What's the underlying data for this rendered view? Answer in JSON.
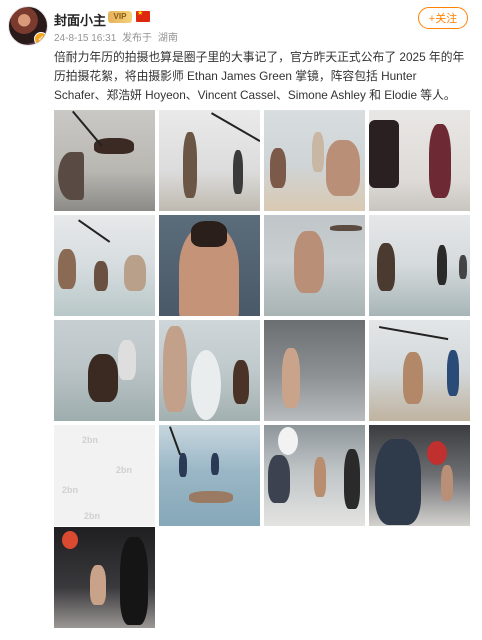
{
  "user": {
    "name": "封面小主",
    "vip_label": "V",
    "date_time": "24-8-15 16:31",
    "device": "发布于",
    "location": "湖南"
  },
  "follow_label": "+关注",
  "post_text": "倍耐力年历的拍摄也算是圈子里的大事记了，官方昨天正式公布了 2025 年的年历拍摄花絮，将由摄影师 Ethan James Green 掌镜，阵容包括 Hunter Schafer、郑浩妍 Hoyeon、Vincent Cassel、Simone Ashley 和 Elodie 等人。",
  "icons": [
    "verified-badge-icon",
    "vip-badge-icon",
    "china-flag-icon"
  ],
  "accent_color": "#ff8200",
  "photos": [
    {
      "name": "photo-1"
    },
    {
      "name": "photo-2"
    },
    {
      "name": "photo-3"
    },
    {
      "name": "photo-4"
    },
    {
      "name": "photo-5"
    },
    {
      "name": "photo-6"
    },
    {
      "name": "photo-7"
    },
    {
      "name": "photo-8"
    },
    {
      "name": "photo-9"
    },
    {
      "name": "photo-10"
    },
    {
      "name": "photo-11"
    },
    {
      "name": "photo-12"
    },
    {
      "name": "photo-13"
    },
    {
      "name": "photo-14"
    },
    {
      "name": "photo-15"
    },
    {
      "name": "photo-16"
    },
    {
      "name": "photo-17"
    }
  ]
}
